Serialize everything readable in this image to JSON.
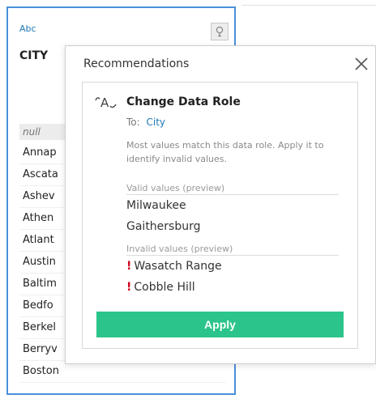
{
  "field": {
    "type_label": "Abc",
    "name": "CITY",
    "name_trail": "",
    "null_label": "null",
    "values": [
      "Annap",
      "Ascata",
      "Ashev",
      "Athen",
      "Atlant",
      "Austin",
      "Baltim",
      "Bedfo",
      "Berkel",
      "Berryv",
      "Boston"
    ]
  },
  "popup": {
    "title": "Recommendations",
    "card": {
      "title": "Change Data Role",
      "to_label": "To:",
      "to_value": "City",
      "description": "Most values match this data role. Apply it to identify invalid values.",
      "valid_label": "Valid values (preview)",
      "valid_values": [
        "Milwaukee",
        "Gaithersburg"
      ],
      "invalid_label": "Invalid values (preview)",
      "invalid_values": [
        "Wasatch Range",
        "Cobble Hill"
      ],
      "invalid_marker": "!",
      "apply_label": "Apply"
    }
  },
  "colors": {
    "accent_blue": "#1f77b4",
    "apply_green": "#2bc48a",
    "invalid_red": "#d0021b",
    "card_border": "#4a90d9"
  },
  "icons": {
    "bulb": "lightbulb-icon",
    "close": "close-icon",
    "data_role": "data-role-icon"
  }
}
